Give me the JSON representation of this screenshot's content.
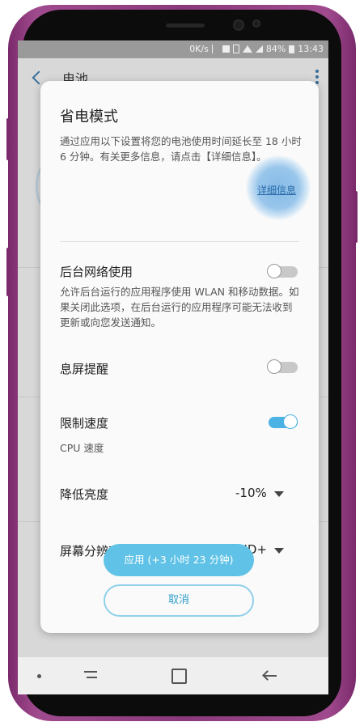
{
  "status_bar": {
    "speed": "0K/s",
    "battery_percent": "84%",
    "time": "13:43"
  },
  "background_page": {
    "title": "电池"
  },
  "dialog": {
    "title": "省电模式",
    "description": "通过应用以下设置将您的电池使用时间延长至 18 小时 6 分钟。有关更多信息，请点击【详细信息】。",
    "details_link": "详细信息",
    "background_network": {
      "title": "后台网络使用",
      "description": "允许后台运行的应用程序使用 WLAN 和移动数据。如果关闭此选项，在后台运行的应用程序可能无法收到更新或向您发送通知。",
      "enabled": false
    },
    "always_on_display": {
      "title": "息屏提醒",
      "enabled": false
    },
    "limit_speed": {
      "title": "限制速度",
      "subtitle": "CPU 速度",
      "enabled": true
    },
    "reduce_brightness": {
      "title": "降低亮度",
      "value": "-10%"
    },
    "screen_resolution": {
      "title": "屏幕分辨率",
      "value": "FHD+"
    },
    "apply_button": "应用 (+3 小时 23 分钟)",
    "cancel_button": "取消"
  },
  "colors": {
    "accent": "#4bb3e3",
    "apply_button": "#5fc2e6",
    "phone_frame": "#8a3a7c"
  }
}
